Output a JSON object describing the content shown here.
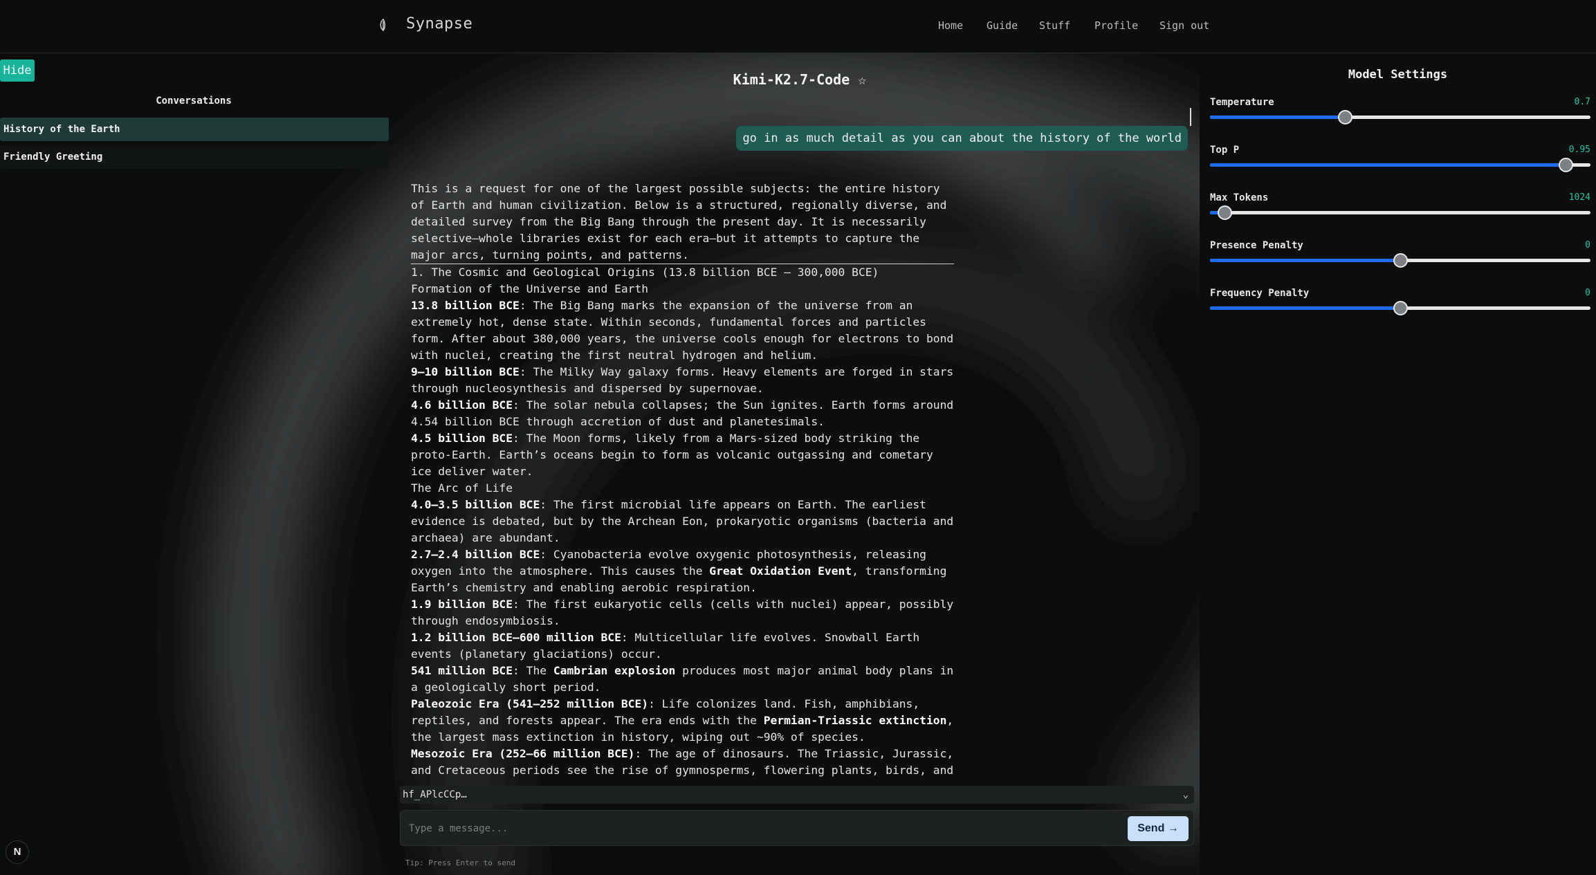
{
  "app": {
    "brand": "Synapse",
    "nav": [
      "Home",
      "Guide",
      "Stuff",
      "Profile",
      "Sign out"
    ]
  },
  "sidebar": {
    "hide_label": "Hide",
    "title": "Conversations",
    "items": [
      {
        "label": "History of the Earth",
        "active": true
      },
      {
        "label": "Friendly Greeting",
        "active": false
      }
    ],
    "badge": "N"
  },
  "chat": {
    "model_title": "Kimi-K2.7-Code ☆",
    "user_message": "go in as much detail as you can about the history of the world",
    "assistant": {
      "intro": "This is a request for one of the largest possible subjects: the entire history of Earth and human civilization. Below is a structured, regionally diverse, and detailed survey from the Big Bang through the present day. It is necessarily selective—whole libraries exist for each era—but it attempts to capture the major arcs, turning points, and patterns.",
      "section1": "1. The Cosmic and Geological Origins (13.8 billion BCE – 300,000 BCE)",
      "sub1": "Formation of the Universe and Earth",
      "p1_b": "13.8 billion BCE",
      "p1": ": The Big Bang marks the expansion of the universe from an extremely hot, dense state. Within seconds, fundamental forces and particles form. After about 380,000 years, the universe cools enough for electrons to bond with nuclei, creating the first neutral hydrogen and helium.",
      "p2_b": "9–10 billion BCE",
      "p2": ": The Milky Way galaxy forms. Heavy elements are forged in stars through nucleosynthesis and dispersed by supernovae.",
      "p3_b": "4.6 billion BCE",
      "p3": ": The solar nebula collapses; the Sun ignites. Earth forms around 4.54 billion BCE through accretion of dust and planetesimals.",
      "p4_b": "4.5 billion BCE",
      "p4": ": The Moon forms, likely from a Mars-sized body striking the proto-Earth. Earth’s oceans begin to form as volcanic outgassing and cometary ice deliver water.",
      "sub2": "The Arc of Life",
      "p5_b": "4.0–3.5 billion BCE",
      "p5": ": The first microbial life appears on Earth. The earliest evidence is debated, but by the Archean Eon, prokaryotic organisms (bacteria and archaea) are abundant.",
      "p6_b": "2.7–2.4 billion BCE",
      "p6a": ": Cyanobacteria evolve oxygenic photosynthesis, releasing oxygen into the atmosphere. This causes the ",
      "p6_b2": "Great Oxidation Event",
      "p6b": ", transforming Earth’s chemistry and enabling aerobic respiration.",
      "p7_b": "1.9 billion BCE",
      "p7": ": The first eukaryotic cells (cells with nuclei) appear, possibly through endosymbiosis.",
      "p8_b": "1.2 billion BCE–600 million BCE",
      "p8": ": Multicellular life evolves. Snowball Earth events (planetary glaciations) occur.",
      "p9_b": "541 million BCE",
      "p9a": ": The ",
      "p9_b2": "Cambrian explosion",
      "p9b": " produces most major animal body plans in a geologically short period.",
      "p10_b": "Paleozoic Era (541–252 million BCE)",
      "p10a": ": Life colonizes land. Fish, amphibians, reptiles, and forests appear. The era ends with the ",
      "p10_b2": "Permian-Triassic extinction",
      "p10b": ", the largest mass extinction in history, wiping out ~90% of species.",
      "p11_b": "Mesozoic Era (252–66 million BCE)",
      "p11": ": The age of dinosaurs. The Triassic, Jurassic, and Cretaceous periods see the rise of gymnosperms, flowering plants, birds, and"
    },
    "api_key_selected": "hf_APlcCCp…",
    "input_placeholder": "Type a message...",
    "send_label": "Send →",
    "tip": "Tip: Press Enter to send"
  },
  "settings": {
    "title": "Model Settings",
    "items": [
      {
        "label": "Temperature",
        "value": "0.7",
        "fraction": 0.355
      },
      {
        "label": "Top P",
        "value": "0.95",
        "fraction": 0.935
      },
      {
        "label": "Max Tokens",
        "value": "1024",
        "fraction": 0.038
      },
      {
        "label": "Presence Penalty",
        "value": "0",
        "fraction": 0.5
      },
      {
        "label": "Frequency Penalty",
        "value": "0",
        "fraction": 0.5
      }
    ]
  },
  "colors": {
    "accent": "#19b39a",
    "user_bubble": "#1f5c53",
    "slider_fill": "#1e6cf0",
    "send_button": "#c9e0fb"
  }
}
